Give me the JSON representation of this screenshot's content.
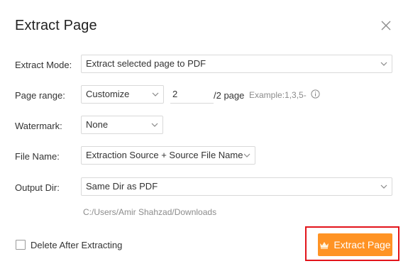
{
  "dialog": {
    "title": "Extract Page",
    "close_icon": "close-icon"
  },
  "extract_mode": {
    "label": "Extract Mode:",
    "value": "Extract selected page to PDF"
  },
  "page_range": {
    "label": "Page range:",
    "mode_value": "Customize",
    "pages_value": "2",
    "total_text": "/2 page",
    "example_text": "Example:1,3,5-",
    "info_icon": "info-icon"
  },
  "watermark": {
    "label": "Watermark:",
    "value": "None"
  },
  "file_name": {
    "label": "File Name:",
    "value": "Extraction Source + Source File Name"
  },
  "output_dir": {
    "label": "Output Dir:",
    "value": "Same Dir as PDF",
    "path": "C:/Users/Amir Shahzad/Downloads"
  },
  "options": {
    "delete_after_label": "Delete After Extracting",
    "delete_after_checked": false
  },
  "actions": {
    "extract_label": "Extract Page",
    "extract_icon": "crown-icon",
    "accent_color": "#ff9324",
    "highlight_color": "#e2141b"
  }
}
